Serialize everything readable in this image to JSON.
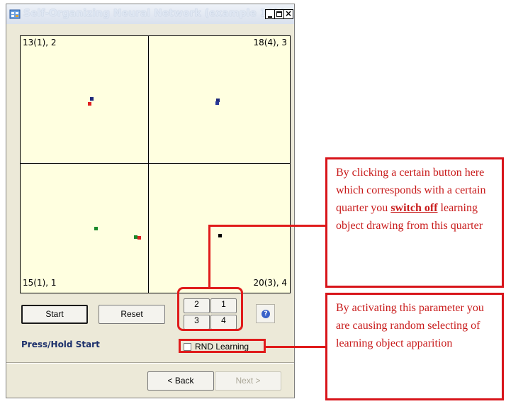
{
  "window": {
    "title": "Self-Organizing Neural Network (example 10b)",
    "controls": {
      "minimize": "_",
      "maximize": "□",
      "close": "×"
    }
  },
  "grid": {
    "quadrants": [
      {
        "label": "13(1), 2",
        "corner": "top-left"
      },
      {
        "label": "18(4), 3",
        "corner": "top-right"
      },
      {
        "label": "15(1), 1",
        "corner": "bottom-left"
      },
      {
        "label": "20(3), 4",
        "corner": "bottom-right"
      }
    ],
    "colors": {
      "navy": "#1f2a7a",
      "red": "#e02020",
      "green": "#1a8a2a",
      "black": "#000000"
    }
  },
  "controls": {
    "start_label": "Start",
    "reset_label": "Reset",
    "quarter_buttons": [
      "2",
      "1",
      "3",
      "4"
    ],
    "help_icon": "?",
    "status_text": "Press/Hold Start",
    "rnd_label": "RND Learning",
    "back_label": "< Back",
    "next_label": "Next >"
  },
  "annotations": {
    "callout1": {
      "text_before": "By clicking a certain button here which corresponds with a certain quarter you ",
      "emphasis": "switch off",
      "text_after": " learning object drawing from this quarter"
    },
    "callout2": {
      "text": "By activating this parameter you are causing random selecting of learning object apparition"
    },
    "accent_color": "#d8141a"
  }
}
